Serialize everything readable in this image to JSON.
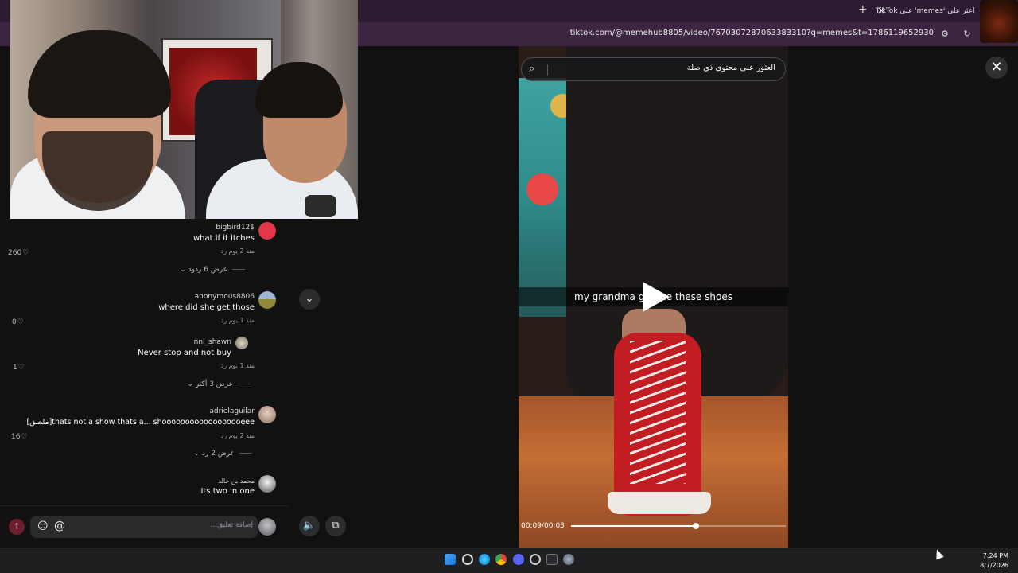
{
  "browser": {
    "tab_title": "اعثر على 'memes' على TikTok |",
    "new_tab": "+",
    "tab_close": "×",
    "url": "tiktok.com/@memehub8805/video/7670307287063383310?q=memes&t=1786119652930"
  },
  "search": {
    "query": "العثور على محتوى ذي صلة"
  },
  "video": {
    "caption": "my grandma got me these shoes",
    "time": "00:09/00:03",
    "progress": 0.58
  },
  "comments": [
    {
      "user": "bigbird12$",
      "text": "what if it itches",
      "meta": "منذ 2 يوم   رد",
      "likes": "260",
      "more": "عرض 6 ردود"
    },
    {
      "user": "anonymous8806",
      "text": "where did she get those",
      "meta": "منذ 1 يوم   رد",
      "likes": "0"
    },
    {
      "user": "nnl_shawn",
      "text": "Never stop and not buy",
      "meta": "منذ 1 يوم   رد",
      "likes": "1",
      "more": "عرض 3 أكثر"
    },
    {
      "user": "adrielaguilar",
      "text": "[ملصق]thats not a show thats a... shoooooooooooooooooeee",
      "meta": "منذ 2 يوم   رد",
      "likes": "16",
      "more": "عرض 2 رد"
    },
    {
      "user": "محمد بن خالد",
      "text": "Its two in one"
    }
  ],
  "composer": {
    "placeholder": "إضافة تعليق...",
    "emoji": "☺",
    "at": "@"
  },
  "clock": {
    "time": "7:24 PM",
    "date": "8/7/2026"
  },
  "colors": {
    "tab_bar": "#2d1b33",
    "address_bar": "#3b2540",
    "page_bg": "#111112",
    "send_button": "#6b1f2c"
  }
}
